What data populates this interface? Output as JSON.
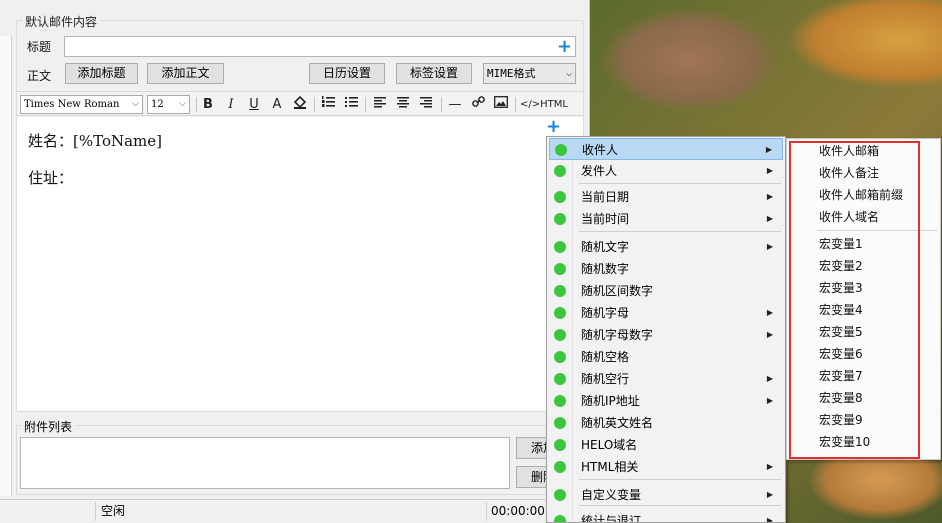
{
  "form": {
    "group_title": "默认邮件内容",
    "title_label": "标题",
    "title_value": "",
    "body_label": "正文",
    "buttons": {
      "add_title": "添加标题",
      "add_body": "添加正文",
      "calendar": "日历设置",
      "tags": "标签设置"
    },
    "format_select": "MIME格式"
  },
  "toolbar": {
    "font": "Times New Roman",
    "size": "12",
    "html_label": "HTML"
  },
  "editor": {
    "line1": "姓名：[%ToName]",
    "line2": "住址："
  },
  "attachments": {
    "title": "附件列表",
    "add_button": "添加",
    "delete_button": "删除"
  },
  "status": {
    "state": "空闲",
    "time": "00:00:00"
  },
  "context_menu": {
    "items": [
      {
        "label": "收件人",
        "submenu": true
      },
      {
        "label": "发件人",
        "submenu": true
      },
      {
        "label": "当前日期",
        "submenu": true
      },
      {
        "label": "当前时间",
        "submenu": true
      },
      {
        "label": "随机文字",
        "submenu": true
      },
      {
        "label": "随机数字",
        "submenu": false
      },
      {
        "label": "随机区间数字",
        "submenu": false
      },
      {
        "label": "随机字母",
        "submenu": true
      },
      {
        "label": "随机字母数字",
        "submenu": true
      },
      {
        "label": "随机空格",
        "submenu": false
      },
      {
        "label": "随机空行",
        "submenu": true
      },
      {
        "label": "随机IP地址",
        "submenu": true
      },
      {
        "label": "随机英文姓名",
        "submenu": false
      },
      {
        "label": "HELO域名",
        "submenu": false
      },
      {
        "label": "HTML相关",
        "submenu": true
      },
      {
        "label": "自定义变量",
        "submenu": true
      },
      {
        "label": "统计与退订",
        "submenu": true
      }
    ],
    "submenu_arrow": "▶"
  },
  "recipient_submenu": {
    "items": [
      "收件人邮箱",
      "收件人备注",
      "收件人邮箱前缀",
      "收件人域名"
    ],
    "macros": [
      "宏变量1",
      "宏变量2",
      "宏变量3",
      "宏变量4",
      "宏变量5",
      "宏变量6",
      "宏变量7",
      "宏变量8",
      "宏变量9",
      "宏变量10"
    ]
  },
  "colors": {
    "highlight": "#b8d8f4",
    "dot": "#3cc63c",
    "annotation": "#e03030",
    "plus": "#1e84d8"
  }
}
